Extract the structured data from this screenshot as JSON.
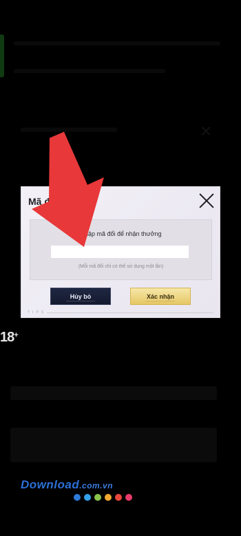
{
  "dialog": {
    "title": "Mã đổi",
    "prompt": "Nhập mã đổi để nhận thưởng",
    "code_value": "",
    "hint": "(Mỗi mã đổi chỉ có thể sử dụng một lần)",
    "cancel_label": "Hủy bỏ",
    "confirm_label": "Xác nhận",
    "tips_label": "TIPS"
  },
  "background": {
    "age_rating": "18",
    "age_rating_suffix": "+"
  },
  "overlay": {
    "arrow_color": "#e8383a"
  },
  "watermark": {
    "text": "Download",
    "suffix": ".com.vn",
    "dot_colors": [
      "#2e79d6",
      "#34a0e8",
      "#8bc34a",
      "#f0a830",
      "#e8473b",
      "#e83a6a"
    ]
  }
}
